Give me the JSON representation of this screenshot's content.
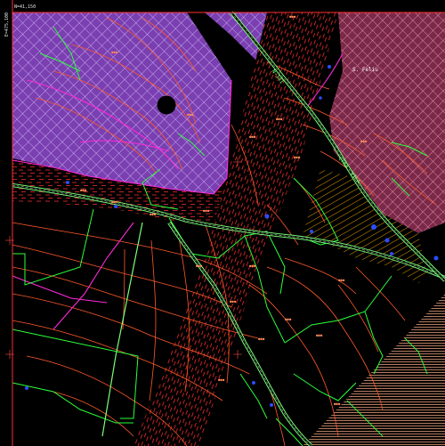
{
  "map": {
    "background_color": "#000000",
    "frame": {
      "corner_label": "N=41,150",
      "side_label": "E=475,100"
    },
    "zones": [
      {
        "id": "zone-violet-hatch",
        "fill": "#7a3fb0",
        "hatch": "#d9c4ff",
        "pattern": "crosshatch"
      },
      {
        "id": "zone-pink-hatch",
        "fill": "#9a3a5a",
        "hatch": "#ff9fbf",
        "pattern": "crosshatch"
      },
      {
        "id": "zone-orange-hatch",
        "fill": "#000000",
        "hatch": "#ffb000",
        "pattern": "diagonal"
      },
      {
        "id": "zone-salmon-band",
        "fill": "#000000",
        "hatch": "#ffb08a",
        "pattern": "horizontal"
      },
      {
        "id": "zone-red-dash",
        "fill": "#000000",
        "hatch": "#ff3030",
        "pattern": "dashed"
      }
    ],
    "place_labels": [
      {
        "id": "place-label-s-feliu",
        "text": "S. Feliu"
      }
    ],
    "road_labels": [
      {
        "id": "road-label-upper",
        "text": "N-141"
      },
      {
        "id": "road-label-middle",
        "text": "CTRA. VILA"
      }
    ],
    "colors": {
      "contour": "#ff5a2a",
      "contour_major": "#ff7a3a",
      "parcel": "#2cff3c",
      "road": "#7aff7a",
      "road_center": "#c8ffc8",
      "magenta": "#ff2ad8",
      "water": "#2a4dff",
      "grid_cross": "#c23a3a"
    }
  }
}
